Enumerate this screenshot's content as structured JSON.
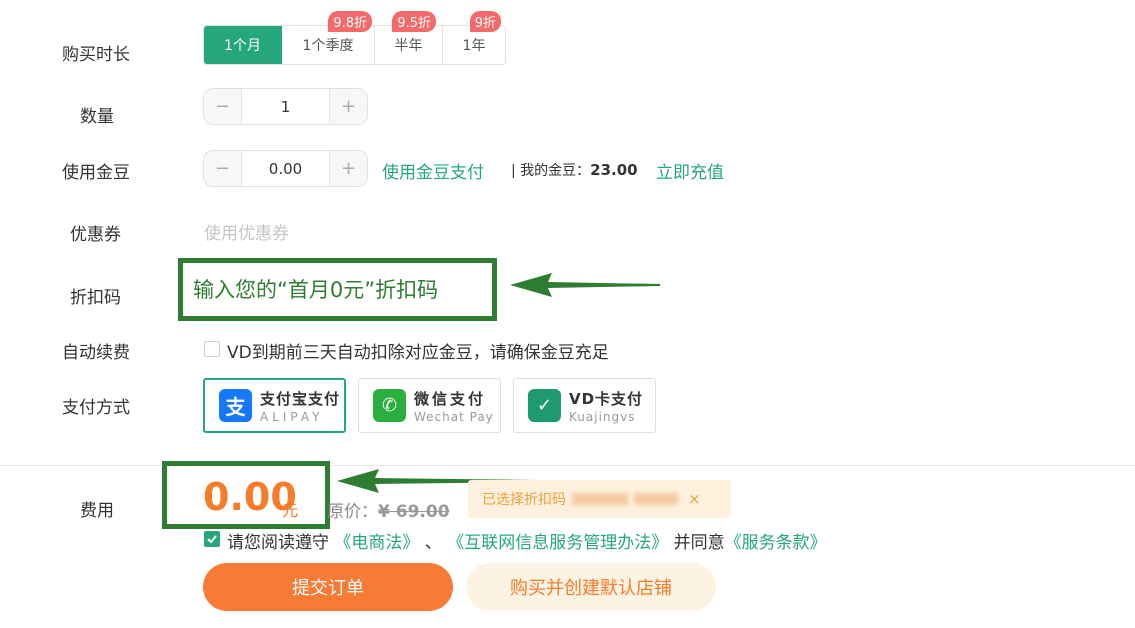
{
  "rows": {
    "duration_label": "购买时长",
    "quantity_label": "数量",
    "beans_label": "使用金豆",
    "coupon_label": "优惠券",
    "discount_code_label": "折扣码",
    "autorenew_label": "自动续费",
    "payment_label": "支付方式",
    "fee_label": "费用"
  },
  "duration": {
    "options": [
      {
        "label": "1个月",
        "badge": ""
      },
      {
        "label": "1个季度",
        "badge": "9.8折"
      },
      {
        "label": "半年",
        "badge": "9.5折"
      },
      {
        "label": "1年",
        "badge": "9折"
      }
    ],
    "selected_index": 0
  },
  "quantity": {
    "minus": "−",
    "value": "1",
    "plus": "+"
  },
  "beans": {
    "minus": "−",
    "value": "0.00",
    "plus": "+",
    "use_link": "使用金豆支付",
    "balance_prefix": "| 我的金豆：",
    "balance": "23.00",
    "recharge_link": "立即充值"
  },
  "coupon": {
    "placeholder": "使用优惠券"
  },
  "discount_code": {
    "annotation": "输入您的“首月0元”折扣码"
  },
  "autorenew": {
    "checked": false,
    "text": "VD到期前三天自动扣除对应金豆，请确保金豆充足"
  },
  "payment": {
    "methods": [
      {
        "icon": "alipay-icon",
        "glyph": "支",
        "name": "支付宝支付",
        "sub": "ALIPAY",
        "color": "#1677ff",
        "selected": true
      },
      {
        "icon": "wechat-icon",
        "glyph": "✆",
        "name": "微信支付",
        "sub": "Wechat Pay",
        "color": "#2aae3f",
        "selected": false
      },
      {
        "icon": "vdcard-icon",
        "glyph": "✓",
        "name": "VD卡支付",
        "sub": "Kuajingvs",
        "color": "#1f9a6e",
        "selected": false
      }
    ]
  },
  "fee": {
    "amount": "0.00",
    "unit": "元",
    "original_label": "原价：",
    "original_price": "¥ 69.00",
    "selected_code_text": "已选择折扣码",
    "close": "×"
  },
  "agreement": {
    "checked": true,
    "prefix": "请您阅读遵守 ",
    "link1": "《电商法》",
    "sep": " 、 ",
    "link2": "《互联网信息服务管理办法》",
    "middle": " 并同意",
    "link3": "《服务条款》"
  },
  "buttons": {
    "submit": "提交订单",
    "buy_create": "购买并创建默认店铺"
  },
  "colors": {
    "accent": "#26a77a",
    "orange": "#f57c2a",
    "annotation": "#2f7d32",
    "badge": "#f26a6a"
  }
}
